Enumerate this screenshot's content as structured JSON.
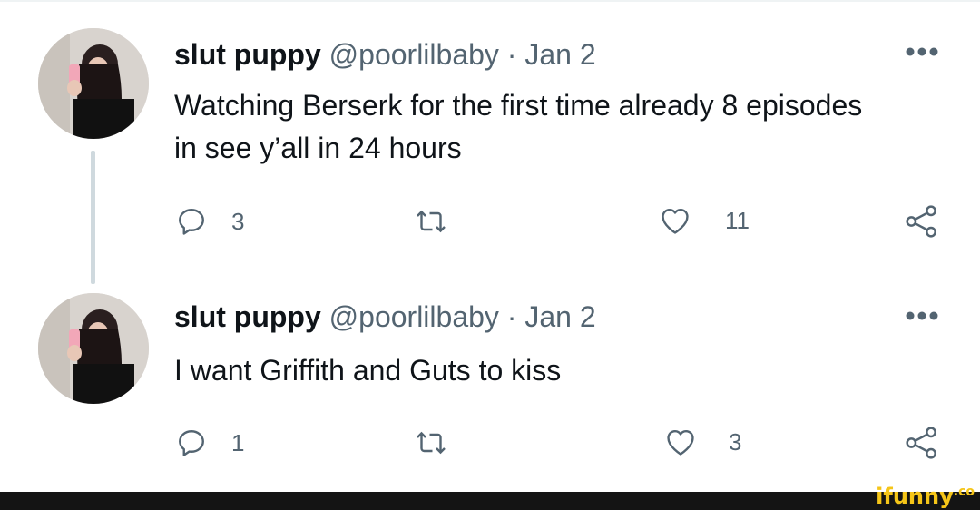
{
  "tweets": [
    {
      "name": "slut puppy",
      "handle": "@poorlilbaby",
      "separator": "·",
      "date": "Jan 2",
      "text": "Watching Berserk for the first time already 8 episodes in see y’all in 24 hours",
      "replies": "3",
      "retweets": "",
      "likes": "11"
    },
    {
      "name": "slut puppy",
      "handle": "@poorlilbaby",
      "separator": "·",
      "date": "Jan 2",
      "text": "I want Griffith and Guts to kiss",
      "replies": "1",
      "retweets": "",
      "likes": "3"
    }
  ],
  "icons": {
    "reply": "reply-icon",
    "retweet": "retweet-icon",
    "like": "heart-icon",
    "share": "share-icon",
    "more": "more-icon"
  },
  "colors": {
    "text": "#0f1419",
    "secondary": "#536471",
    "thread_line": "#cfd9de",
    "watermark": "#f5c518"
  },
  "watermark": {
    "text": "ifunny",
    "suffix": ".co"
  }
}
